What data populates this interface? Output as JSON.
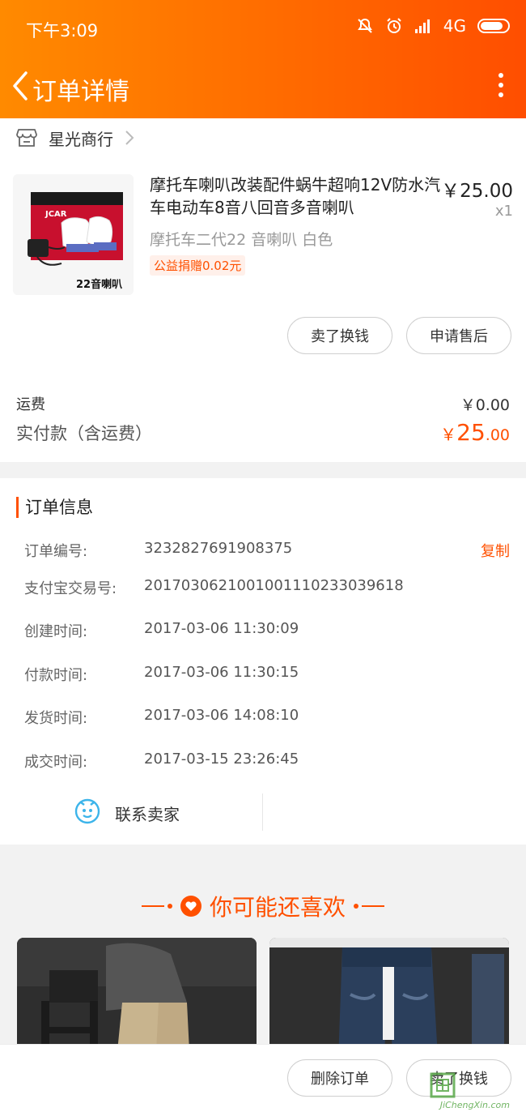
{
  "status_bar": {
    "time": "下午3:09",
    "network": "4G"
  },
  "navbar": {
    "title": "订单详情"
  },
  "shop": {
    "name": "星光商行"
  },
  "product": {
    "title": "摩托车喇叭改装配件蜗牛超响12V防水汽车电动车8音八回音多音喇叭",
    "price": "￥25.00",
    "quantity": "x1",
    "sku": "摩托车二代22 音喇叭 白色",
    "donation": "公益捐赠0.02元",
    "image_caption": "22音喇叭",
    "image_brand": "JCAR"
  },
  "item_actions": {
    "sell": "卖了换钱",
    "after_sale": "申请售后"
  },
  "summary": {
    "shipping_label": "运费",
    "shipping_value": "￥0.00",
    "paid_label": "实付款（含运费）",
    "paid_currency": "￥",
    "paid_integer": "25",
    "paid_decimal": ".00"
  },
  "order_info": {
    "title": "订单信息",
    "copy_label": "复制",
    "rows": [
      {
        "label": "订单编号:",
        "value": "3232827691908375"
      },
      {
        "label": "支付宝交易号:",
        "value": "2017030621001001110233039618"
      },
      {
        "label": "创建时间:",
        "value": "2017-03-06 11:30:09"
      },
      {
        "label": "付款时间:",
        "value": "2017-03-06 11:30:15"
      },
      {
        "label": "发货时间:",
        "value": "2017-03-06 14:08:10"
      },
      {
        "label": "成交时间:",
        "value": "2017-03-15 23:26:45"
      }
    ]
  },
  "contact": {
    "label": "联系卖家"
  },
  "recommend": {
    "title": "你可能还喜欢"
  },
  "bottom_actions": {
    "delete": "删除订单",
    "sell": "卖了换钱"
  },
  "watermark": {
    "text": "JiChengXin.com"
  },
  "colors": {
    "accent": "#ff5000",
    "header_start": "#ff8a00",
    "header_end": "#ff4e00"
  }
}
